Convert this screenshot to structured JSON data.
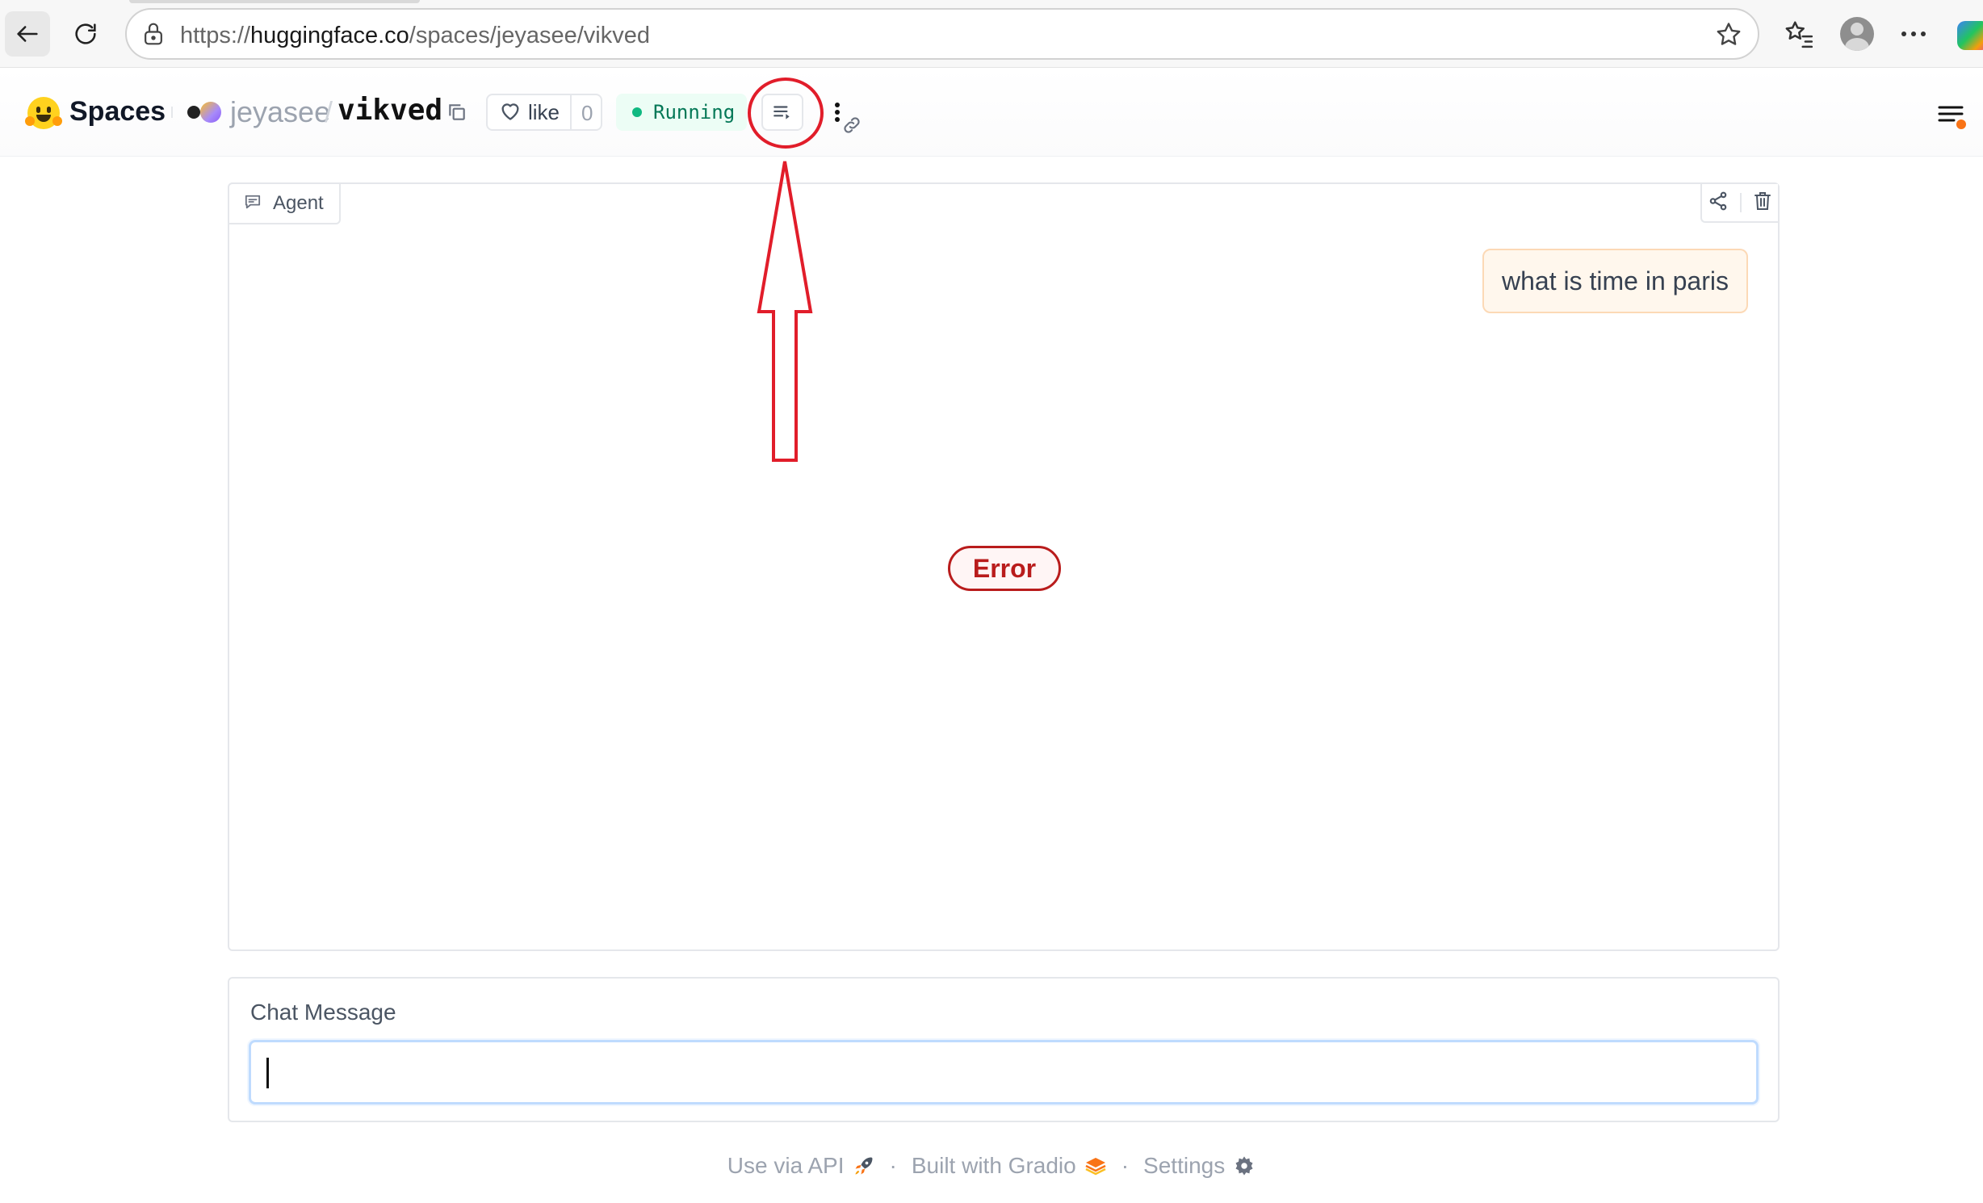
{
  "browser": {
    "url_prefix": "https://",
    "url_domain": "huggingface.co",
    "url_path": "/spaces/jeyasee/vikved"
  },
  "header": {
    "brand": "Spaces",
    "owner": "jeyasee",
    "separator": "/",
    "space": "vikved",
    "like_label": "like",
    "like_count": "0",
    "status": "Running"
  },
  "chat": {
    "label": "Agent",
    "messages": [
      {
        "role": "user",
        "text": "what is time in paris"
      }
    ],
    "error_label": "Error"
  },
  "input": {
    "label": "Chat Message",
    "value": "",
    "placeholder": ""
  },
  "footer": {
    "api": "Use via API",
    "built": "Built with Gradio",
    "settings": "Settings",
    "dot": "·"
  },
  "colors": {
    "annotation": "#e11d2a",
    "status_green": "#10b981",
    "error_red": "#b91c1c"
  }
}
